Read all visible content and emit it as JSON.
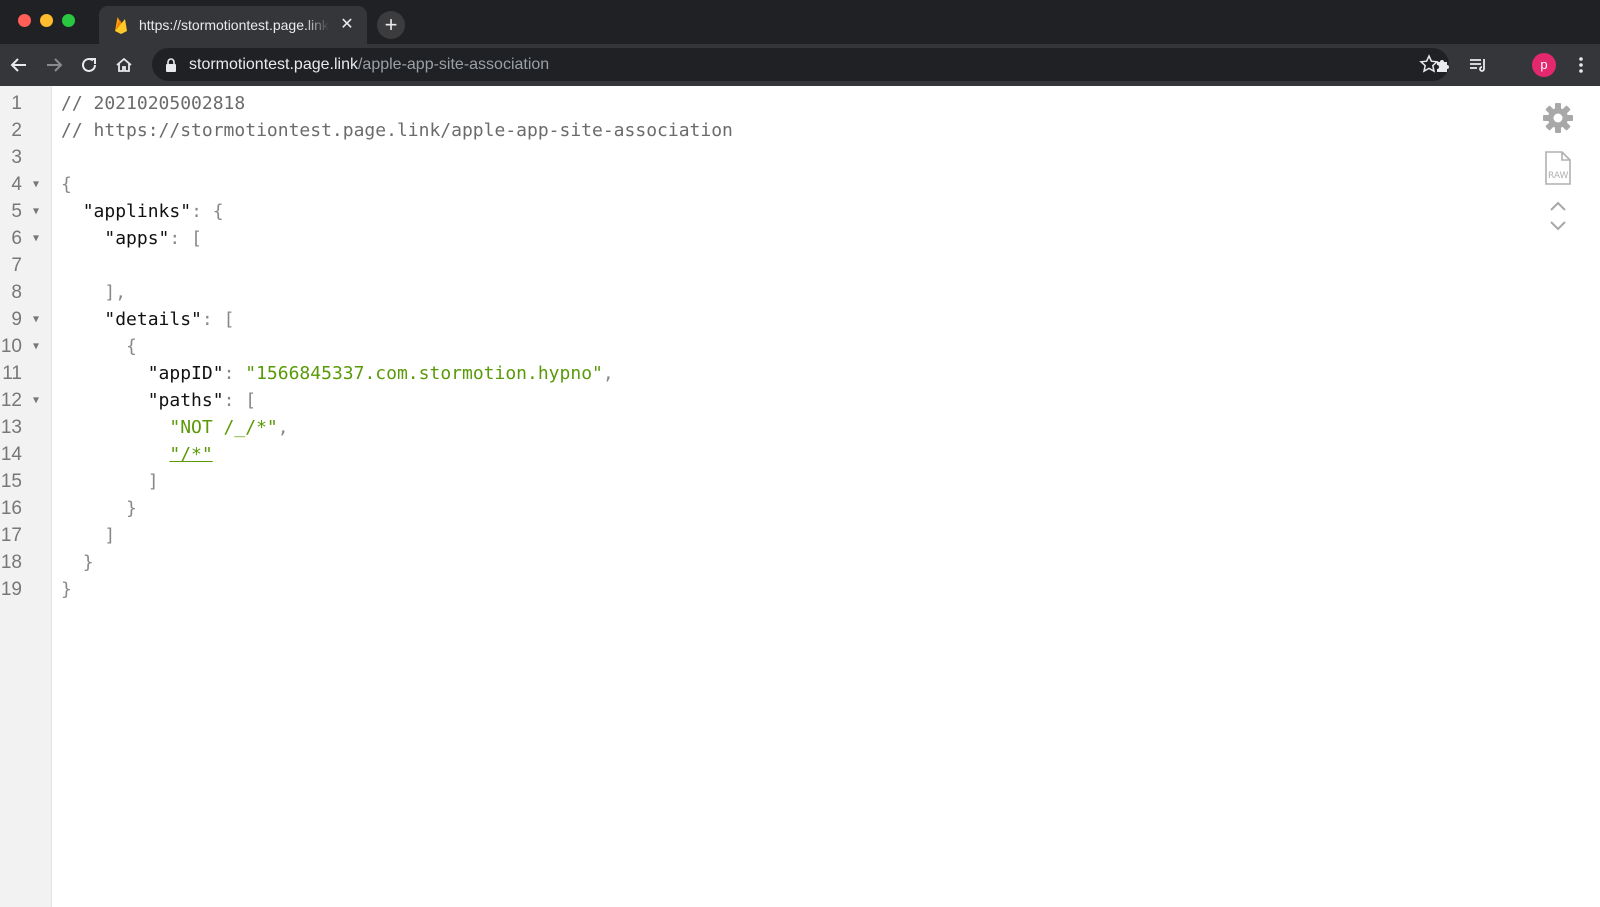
{
  "browser": {
    "tab": {
      "title": "https://stormotiontest.page.link",
      "close_glyph": "✕"
    },
    "new_tab_glyph": "+",
    "omnibox": {
      "host": "stormotiontest.page.link",
      "path": "/apple-app-site-association"
    },
    "avatar_letter": "p",
    "accent": "#e3286e"
  },
  "viewer": {
    "lines": [
      {
        "n": "1",
        "fold": "",
        "tokens": [
          {
            "t": "// 20210205002818",
            "c": "c-comment"
          }
        ]
      },
      {
        "n": "2",
        "fold": "",
        "tokens": [
          {
            "t": "// https://stormotiontest.page.link/apple-app-site-association",
            "c": "c-comment"
          }
        ]
      },
      {
        "n": "3",
        "fold": "",
        "tokens": []
      },
      {
        "n": "4",
        "fold": "▼",
        "tokens": [
          {
            "t": "{",
            "c": "c-punct"
          }
        ]
      },
      {
        "n": "5",
        "fold": "▼",
        "tokens": [
          {
            "t": "  ",
            "c": ""
          },
          {
            "t": "\"applinks\"",
            "c": "c-key"
          },
          {
            "t": ": {",
            "c": "c-punct"
          }
        ]
      },
      {
        "n": "6",
        "fold": "▼",
        "tokens": [
          {
            "t": "    ",
            "c": ""
          },
          {
            "t": "\"apps\"",
            "c": "c-key"
          },
          {
            "t": ": [",
            "c": "c-punct"
          }
        ]
      },
      {
        "n": "7",
        "fold": "",
        "tokens": []
      },
      {
        "n": "8",
        "fold": "",
        "tokens": [
          {
            "t": "    ",
            "c": ""
          },
          {
            "t": "],",
            "c": "c-punct"
          }
        ]
      },
      {
        "n": "9",
        "fold": "▼",
        "tokens": [
          {
            "t": "    ",
            "c": ""
          },
          {
            "t": "\"details\"",
            "c": "c-key"
          },
          {
            "t": ": [",
            "c": "c-punct"
          }
        ]
      },
      {
        "n": "10",
        "fold": "▼",
        "tokens": [
          {
            "t": "      ",
            "c": ""
          },
          {
            "t": "{",
            "c": "c-punct"
          }
        ]
      },
      {
        "n": "11",
        "fold": "",
        "tokens": [
          {
            "t": "        ",
            "c": ""
          },
          {
            "t": "\"appID\"",
            "c": "c-key"
          },
          {
            "t": ": ",
            "c": "c-punct"
          },
          {
            "t": "\"1566845337.com.stormotion.hypno\"",
            "c": "c-str"
          },
          {
            "t": ",",
            "c": "c-punct"
          }
        ]
      },
      {
        "n": "12",
        "fold": "▼",
        "tokens": [
          {
            "t": "        ",
            "c": ""
          },
          {
            "t": "\"paths\"",
            "c": "c-key"
          },
          {
            "t": ": [",
            "c": "c-punct"
          }
        ]
      },
      {
        "n": "13",
        "fold": "",
        "tokens": [
          {
            "t": "          ",
            "c": ""
          },
          {
            "t": "\"NOT /_/*\"",
            "c": "c-str"
          },
          {
            "t": ",",
            "c": "c-punct"
          }
        ]
      },
      {
        "n": "14",
        "fold": "",
        "tokens": [
          {
            "t": "          ",
            "c": ""
          },
          {
            "t": "\"/*\"",
            "c": "c-str underline"
          }
        ]
      },
      {
        "n": "15",
        "fold": "",
        "tokens": [
          {
            "t": "        ",
            "c": ""
          },
          {
            "t": "]",
            "c": "c-punct"
          }
        ]
      },
      {
        "n": "16",
        "fold": "",
        "tokens": [
          {
            "t": "      ",
            "c": ""
          },
          {
            "t": "}",
            "c": "c-punct"
          }
        ]
      },
      {
        "n": "17",
        "fold": "",
        "tokens": [
          {
            "t": "    ",
            "c": ""
          },
          {
            "t": "]",
            "c": "c-punct"
          }
        ]
      },
      {
        "n": "18",
        "fold": "",
        "tokens": [
          {
            "t": "  ",
            "c": ""
          },
          {
            "t": "}",
            "c": "c-punct"
          }
        ]
      },
      {
        "n": "19",
        "fold": "",
        "tokens": [
          {
            "t": "}",
            "c": "c-punct"
          }
        ]
      }
    ],
    "tools": [
      "gear-icon",
      "raw-icon",
      "chevron-up-icon",
      "chevron-down-icon"
    ]
  }
}
